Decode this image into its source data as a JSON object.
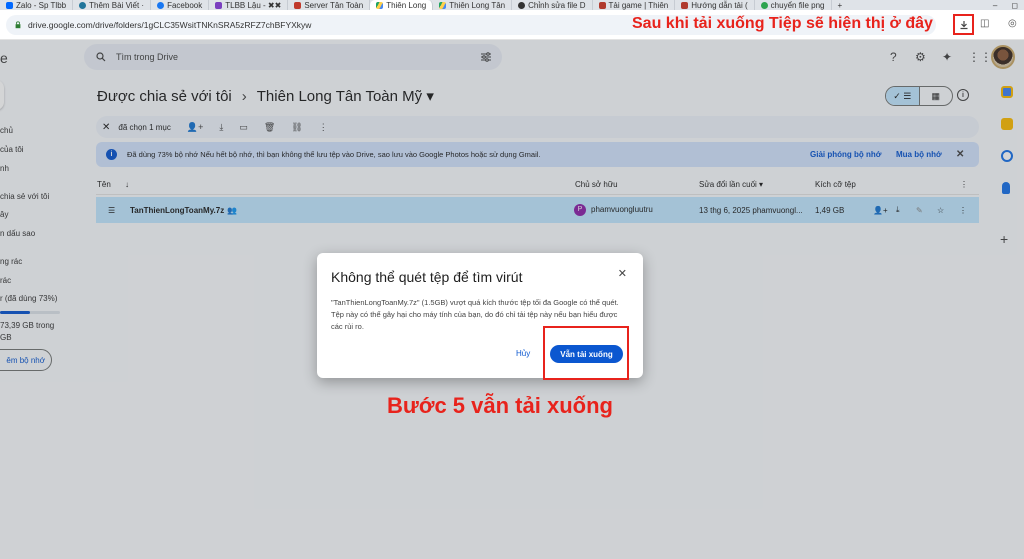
{
  "tabs": [
    {
      "label": "Zalo - Sp Tlbb",
      "color": "#0068ff"
    },
    {
      "label": "Thêm Bài Viết ·",
      "color": "#21759b"
    },
    {
      "label": "Facebook",
      "color": "#1877f2"
    },
    {
      "label": "TLBB Lậu - ✖✖",
      "color": "#7b3fbf"
    },
    {
      "label": "Server Tân Toàn",
      "color": "#c0392b"
    },
    {
      "label": "Thiên Long",
      "color": "#1fa463"
    },
    {
      "label": "Thiên Long Tân",
      "color": "#1fa463"
    },
    {
      "label": "Chỉnh sửa file D",
      "color": "#333333"
    },
    {
      "label": "Tải game | Thiên",
      "color": "#b03a2e"
    },
    {
      "label": "Hướng dẫn tải (",
      "color": "#b03a2e"
    },
    {
      "label": "chuyển file png",
      "color": "#2ea44f"
    }
  ],
  "window": {
    "new_tab": "+",
    "minimize": "–",
    "restore": "◻"
  },
  "address": {
    "url": "drive.google.com/drive/folders/1gCLC35WsitTNKnSRA5zRFZ7chBFYXkyw"
  },
  "annotations": {
    "top": "Sau khi tải xuống Tiệp sẽ hiện thị ở đây",
    "step": "Bước 5 vẫn tải xuống"
  },
  "drive": {
    "logo_fragment": "e",
    "nav": [
      "chủ",
      "của tôi",
      "nh",
      "chia sẻ với tôi",
      "ây",
      "n dấu sao",
      "ng rác",
      "rác",
      "r (đã dùng 73%)",
      "73,39 GB trong",
      "GB"
    ],
    "buy_storage": "êm bộ nhớ",
    "search_placeholder": "Tìm trong Drive",
    "breadcrumb_root": "Được chia sẻ với tôi",
    "breadcrumb_sep": "›",
    "breadcrumb_current": "Thiên Long Tân Toàn Mỹ ▾",
    "selection_count": "đã chọn 1 mục",
    "banner_text": "Đã dùng 73% bộ nhớ Nếu hết bộ nhớ, thì bạn không thể lưu tệp vào Drive, sao lưu vào Google Photos hoặc sử dụng Gmail.",
    "banner_free": "Giải phóng bộ nhớ",
    "banner_buy": "Mua bộ nhớ",
    "columns": {
      "name": "Tên",
      "owner": "Chủ sở hữu",
      "modified": "Sửa đổi lần cuối ▾",
      "size": "Kích cỡ tệp"
    },
    "file": {
      "name": "TanThienLongToanMy.7z",
      "owner_initial": "P",
      "owner": "phamvuongluutru",
      "modified": "13 thg 6, 2025 phamvuongl...",
      "size": "1,49 GB"
    }
  },
  "dialog": {
    "title": "Không thể quét tệp để tìm virút",
    "body": "\"TanThienLongToanMy.7z\" (1.5GB) vượt quá kích thước tệp tối đa Google có thể quét. Tệp này có thể gây hại cho máy tính của bạn, do đó chỉ tải tệp này nếu bạn hiểu được các rủi ro.",
    "cancel": "Hủy",
    "download_anyway": "Vẫn tải xuống"
  }
}
